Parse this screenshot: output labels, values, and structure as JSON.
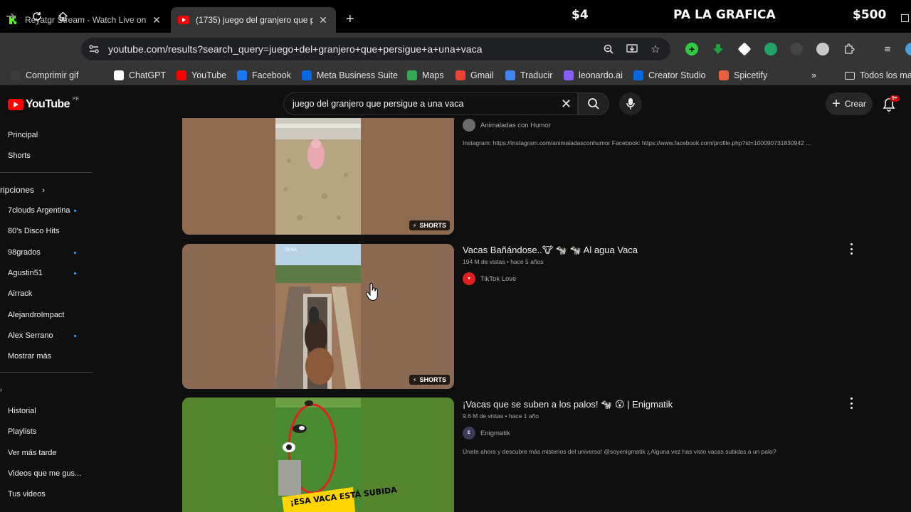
{
  "browser": {
    "tabs": [
      {
        "title": "Reyatgr Stream - Watch Live on",
        "favicon": "kick-icon",
        "active": false
      },
      {
        "title": "(1735) juego del granjero que p",
        "favicon": "youtube-icon",
        "active": true
      }
    ],
    "stream_overlay": {
      "left": "$4",
      "center": "PA LA GRAFICA",
      "right": "$500"
    },
    "url": "youtube.com/results?search_query=juego+del+granjero+que+persigue+a+una+vaca",
    "bookmarks": [
      {
        "label": "Comprimir gif",
        "icon": "gif-icon",
        "color": "#3b3b3b"
      },
      {
        "label": "ChatGPT",
        "icon": "chatgpt-icon",
        "color": "#ffffff"
      },
      {
        "label": "YouTube",
        "icon": "youtube-icon",
        "color": "#ff0000"
      },
      {
        "label": "Facebook",
        "icon": "facebook-icon",
        "color": "#1877f2"
      },
      {
        "label": "Meta Business Suite",
        "icon": "meta-icon",
        "color": "#0668e1"
      },
      {
        "label": "Maps",
        "icon": "maps-icon",
        "color": "#34a853"
      },
      {
        "label": "Gmail",
        "icon": "gmail-icon",
        "color": "#ea4335"
      },
      {
        "label": "Traducir",
        "icon": "translate-icon",
        "color": "#4285f4"
      },
      {
        "label": "leonardo.ai",
        "icon": "leonardo-icon",
        "color": "#8a5cf6"
      },
      {
        "label": "Creator Studio",
        "icon": "meta-icon",
        "color": "#0668e1"
      },
      {
        "label": "Spicetify",
        "icon": "spicetify-icon",
        "color": "#e8603c"
      }
    ],
    "all_bookmarks_label": "Todos los ma"
  },
  "youtube": {
    "logo_text": "YouTube",
    "country_code": "PE",
    "search_query": "juego del granjero que persigue a una vaca",
    "create_label": "Crear",
    "notification_count": "9+"
  },
  "sidebar": {
    "top": [
      {
        "label": "Principal"
      },
      {
        "label": "Shorts"
      }
    ],
    "subscriptions_heading": "ripciones",
    "subscriptions": [
      {
        "label": "7clouds Argentina",
        "new": true
      },
      {
        "label": "80's Disco Hits",
        "new": false
      },
      {
        "label": "98grados",
        "new": true
      },
      {
        "label": "Agustin51",
        "new": true
      },
      {
        "label": "Airrack",
        "new": false
      },
      {
        "label": "AlejandroImpact",
        "new": false
      },
      {
        "label": "Alex Serrano",
        "new": true
      },
      {
        "label": "Mostrar más",
        "new": false
      }
    ],
    "you": [
      {
        "label": "Historial"
      },
      {
        "label": "Playlists"
      },
      {
        "label": "Ver más tarde"
      },
      {
        "label": "Videos que me gus..."
      },
      {
        "label": "Tus videos"
      }
    ]
  },
  "results": [
    {
      "channel": "Animaladas con Humor",
      "description": "Instagram: https://instagram.com/animaladasconhumor Facebook: https://www.facebook.com/profile.php?id=100090731830942 ...",
      "badge": "SHORTS"
    },
    {
      "title": "Vacas Bañándose..🐮 🐄 🐄 Al agua Vaca",
      "meta": "194 M de vistas • hace 5 años",
      "channel": "TikTok Love",
      "badge": "SHORTS",
      "watermark": "TikTok"
    },
    {
      "title": "¡Vacas que se suben a los palos! 🐄 😮 | Enigmatik",
      "meta": "9.6 M de vistas • hace 1 año",
      "channel": "Enigmatik",
      "description": "Únete ahora y descubre más misterios del universo! @soyenigmatik ¿Alguna vez has visto vacas subidas a un palo?",
      "thumb_caption": "¡ESA VACA ESTÁ SUBIDA"
    }
  ]
}
